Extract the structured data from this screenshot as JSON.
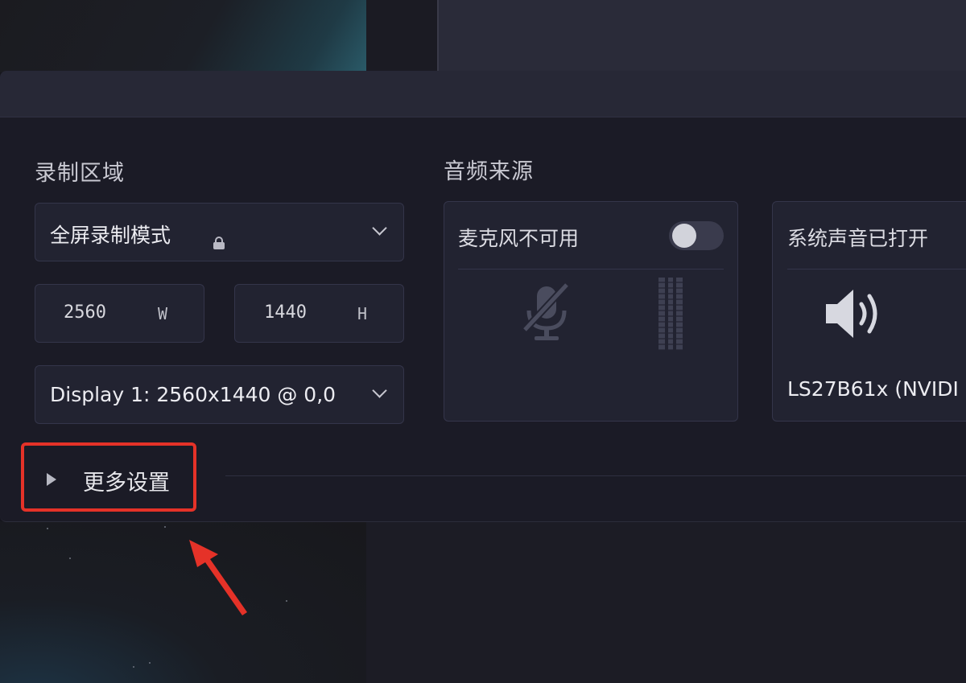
{
  "recording_area": {
    "title": "录制区域",
    "mode_select": {
      "value": "全屏录制模式"
    },
    "width": {
      "value": "2560",
      "unit": "W"
    },
    "height": {
      "value": "1440",
      "unit": "H"
    },
    "display_select": {
      "value": "Display 1: 2560x1440 @ 0,0"
    }
  },
  "audio_source": {
    "title": "音频来源",
    "microphone": {
      "label": "麦克风不可用",
      "toggle_on": false
    },
    "system_audio": {
      "label": "系统声音已打开",
      "device": "LS27B61x (NVIDI"
    }
  },
  "more_settings": {
    "label": "更多设置"
  },
  "colors": {
    "panel_bg": "#1b1b26",
    "highlight_border": "#e53228",
    "accent_text": "#e6e6ea"
  }
}
